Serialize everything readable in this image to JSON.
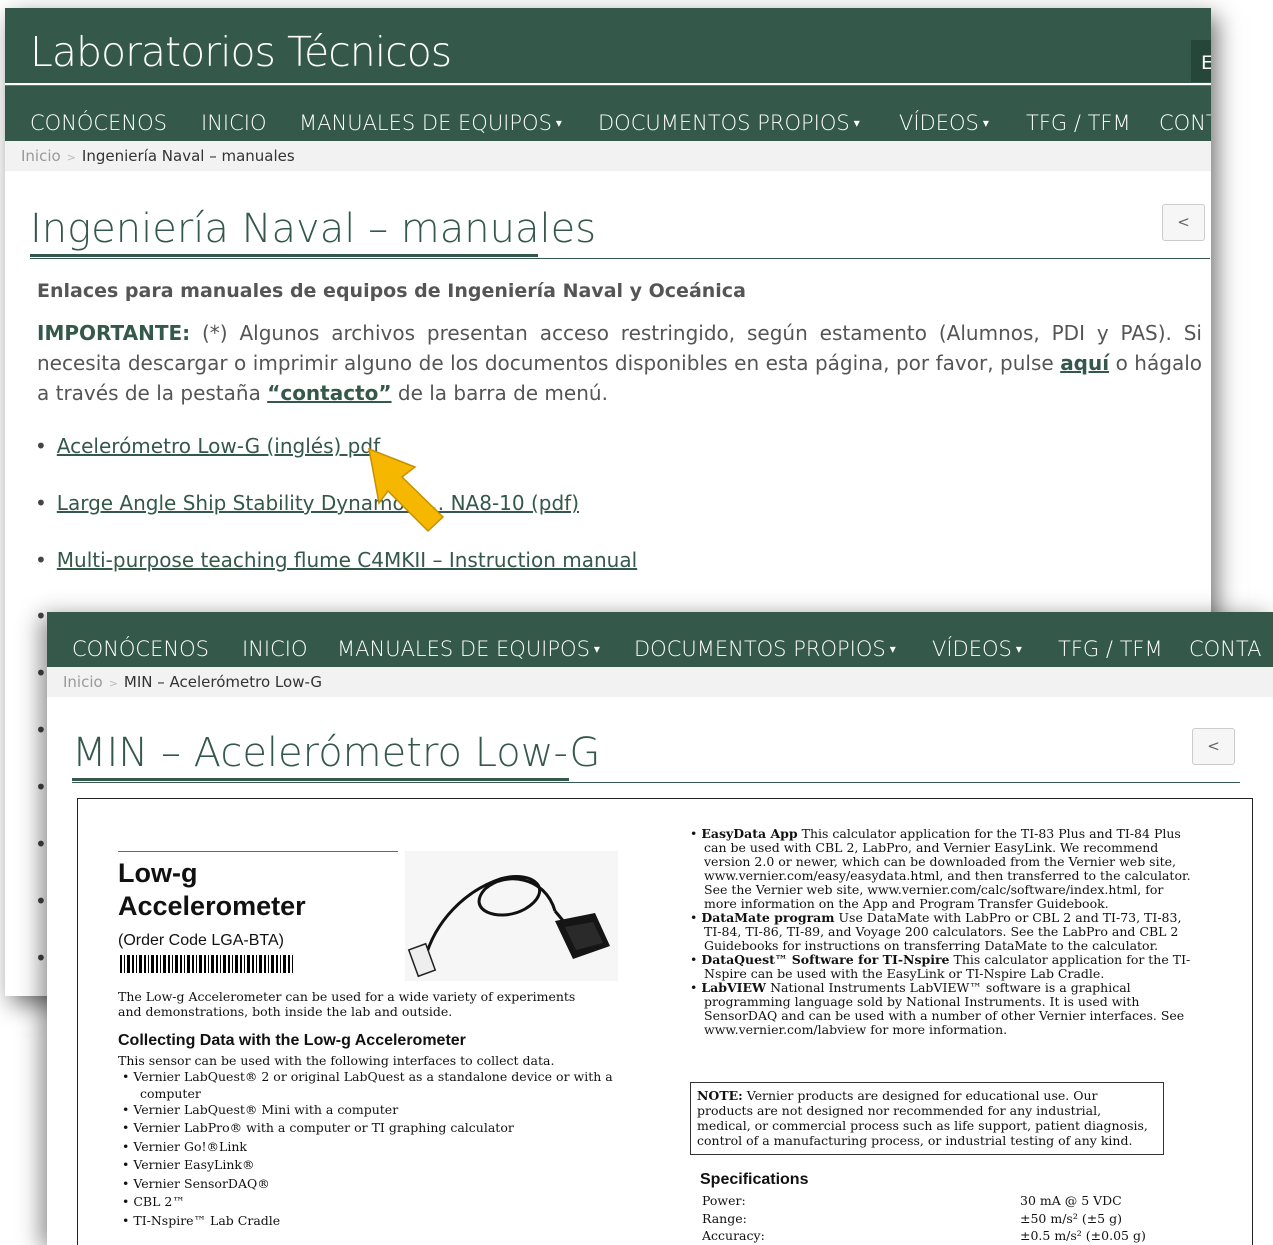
{
  "site": {
    "title": "Laboratorios Técnicos",
    "lang_button": "E"
  },
  "nav": {
    "items": [
      {
        "label": "CONÓCENOS"
      },
      {
        "label": "INICIO"
      },
      {
        "label": "MANUALES DE EQUIPOS",
        "dropdown": true
      },
      {
        "label": "DOCUMENTOS PROPIOS",
        "dropdown": true
      },
      {
        "label": "VÍDEOS",
        "dropdown": true
      },
      {
        "label": "TFG / TFM"
      },
      {
        "label": "CONT"
      }
    ],
    "last_label_page2": "CONTA",
    "caret": "▾"
  },
  "page1": {
    "breadcrumb": {
      "home": "Inicio",
      "sep": ">",
      "current": "Ingeniería Naval – manuales"
    },
    "title": "Ingeniería Naval – manuales",
    "subtitle": "Enlaces para manuales de equipos de Ingeniería Naval y Oceánica",
    "important": {
      "label": "IMPORTANTE:",
      "text1": " (*) Algunos archivos presentan acceso restringido, según estamento (Alumnos, PDI y PAS). Si necesita descargar o imprimir alguno de los documentos disponibles en esta página, por favor, pulse ",
      "link_here": "aquí",
      "text2": " o hágalo a través de la pestaña ",
      "link_contact": "“contacto”",
      "text3": " de la barra de menú."
    },
    "links": [
      {
        "label": "Acelerómetro Low-G (inglés) pdf"
      },
      {
        "label": "Large Angle Ship Stability Dynamom… NA8-10 (pdf)"
      },
      {
        "label": "Multi-purpose teaching flume C4MKII – Instruction manual"
      }
    ],
    "bullet": "•"
  },
  "page2": {
    "breadcrumb": {
      "home": "Inicio",
      "sep": ">",
      "current": "MIN – Acelerómetro Low-G"
    },
    "title": "MIN – Acelerómetro Low-G"
  },
  "share_icon": "share-icon",
  "share_glyph": "<",
  "pdf": {
    "title_line1": "Low-g",
    "title_line2": "Accelerometer",
    "order_code": "(Order Code LGA-BTA)",
    "intro": "The Low-g Accelerometer can be used for a wide variety of experiments and demonstrations, both inside the lab and outside.",
    "collect_heading": "Collecting Data with the Low-g Accelerometer",
    "collect_text": "This sensor can be used with the following interfaces to collect data.",
    "interfaces": [
      "Vernier LabQuest® 2 or original LabQuest as a standalone device or with a",
      "computer",
      "Vernier LabQuest® Mini with a computer",
      "Vernier LabPro® with a computer or TI graphing calculator",
      "Vernier Go!®Link",
      "Vernier EasyLink®",
      "Vernier SensorDAQ®",
      "CBL 2™",
      "TI-Nspire™ Lab Cradle"
    ],
    "right_items": [
      {
        "bold": "EasyData App",
        "text": "  This calculator application for the TI-83 Plus and TI-84 Plus can be used with CBL 2, LabPro, and Vernier EasyLink. We recommend version 2.0 or newer, which can be downloaded from the Vernier web site, www.vernier.com/easy/easydata.html, and then transferred to the calculator. See the Vernier web site, www.vernier.com/calc/software/index.html, for more information on the App and Program Transfer Guidebook."
      },
      {
        "bold": "DataMate program",
        "text": "  Use DataMate with LabPro or CBL 2 and TI-73, TI-83, TI-84, TI-86, TI-89, and Voyage 200 calculators. See the LabPro and CBL 2 Guidebooks for instructions on transferring DataMate to the calculator."
      },
      {
        "bold": "DataQuest™ Software for TI-Nspire",
        "text": " This calculator application for the TI-Nspire can be used with the EasyLink or TI-Nspire Lab Cradle."
      },
      {
        "bold": "LabVIEW",
        "text": "  National Instruments LabVIEW™ software is a graphical programming language sold by National Instruments. It is used with SensorDAQ and can be used with a number of other Vernier interfaces. See www.vernier.com/labview for more information."
      }
    ],
    "note_label": "NOTE:",
    "note_text": " Vernier products are designed for educational use. Our products are not designed nor recommended for any industrial, medical, or commercial process such as life support, patient diagnosis, control of a manufacturing process, or industrial testing of any kind.",
    "specs_heading": "Specifications",
    "specs": [
      {
        "label": "Power:",
        "value": "30 mA @ 5 VDC"
      },
      {
        "label": "Range:",
        "value": "±50 m/s² (±5 g)"
      },
      {
        "label": "Accuracy:",
        "value": "±0.5 m/s² (±0.05 g)"
      }
    ]
  }
}
